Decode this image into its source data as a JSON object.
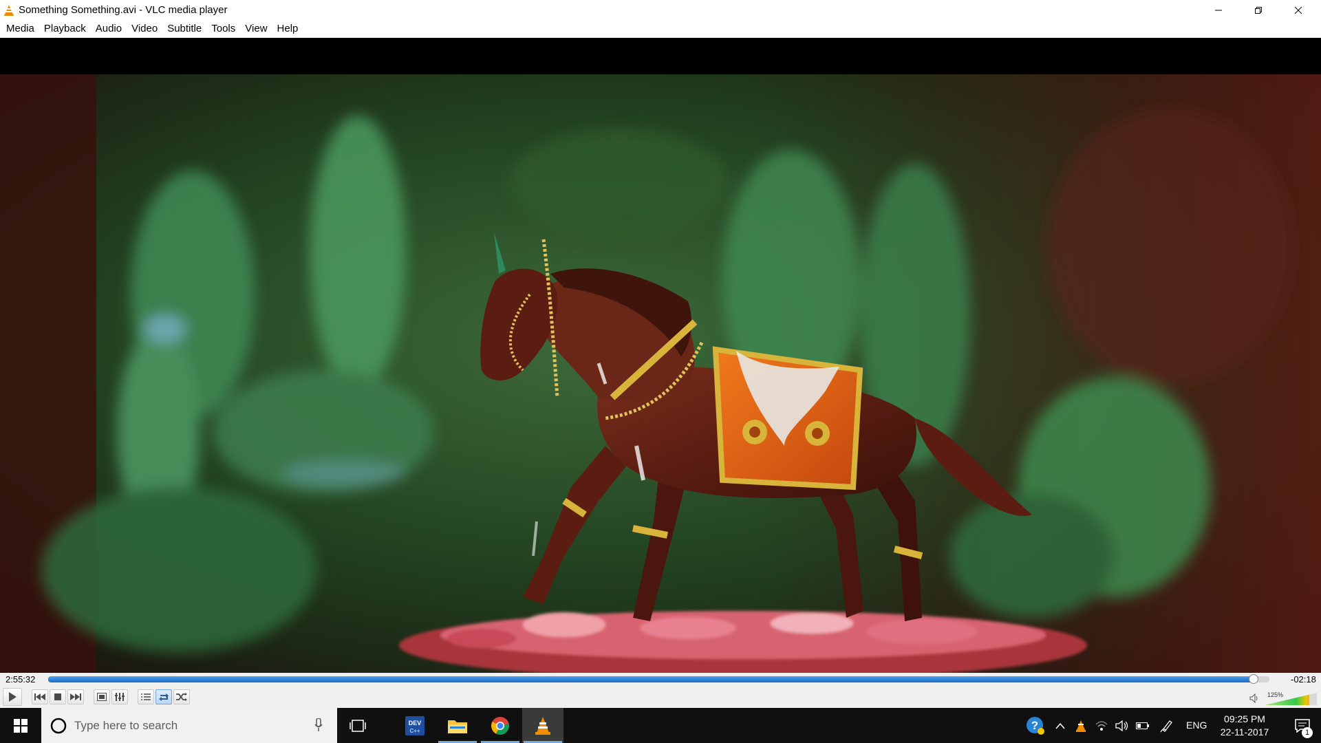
{
  "window": {
    "title": "Something Something.avi - VLC media player",
    "app_icon": "vlc-cone-icon",
    "controls": [
      "minimize-icon",
      "restore-icon",
      "close-icon"
    ]
  },
  "menu": {
    "items": [
      {
        "label": "Media"
      },
      {
        "label": "Playback"
      },
      {
        "label": "Audio"
      },
      {
        "label": "Video"
      },
      {
        "label": "Subtitle"
      },
      {
        "label": "Tools"
      },
      {
        "label": "View"
      },
      {
        "label": "Help"
      }
    ]
  },
  "player": {
    "elapsed": "2:55:32",
    "remaining": "-02:18",
    "progress_fraction": 0.987,
    "volume_label": "125%",
    "volume_fraction": 0.85,
    "controls": [
      "play-icon",
      "previous-icon",
      "stop-icon",
      "next-icon",
      "fullscreen-icon",
      "extended-settings-icon",
      "playlist-icon",
      "loop-icon",
      "shuffle-icon"
    ],
    "loop_active": true
  },
  "taskbar": {
    "search_placeholder": "Type here to search",
    "pinned": [
      "task-view-icon",
      "devcpp-icon",
      "file-explorer-icon",
      "chrome-icon",
      "vlc-icon"
    ],
    "tray": [
      "help-icon",
      "chevron-up-icon",
      "vlc-tray-icon",
      "wifi-icon",
      "speaker-icon",
      "battery-icon",
      "pen-icon"
    ],
    "language": "ENG",
    "time": "09:25 PM",
    "date": "22-11-2017",
    "notification_count": "1"
  },
  "colors": {
    "vlc_orange": "#f08c00",
    "seek_blue": "#1c6cc7",
    "taskbar": "#101010"
  }
}
